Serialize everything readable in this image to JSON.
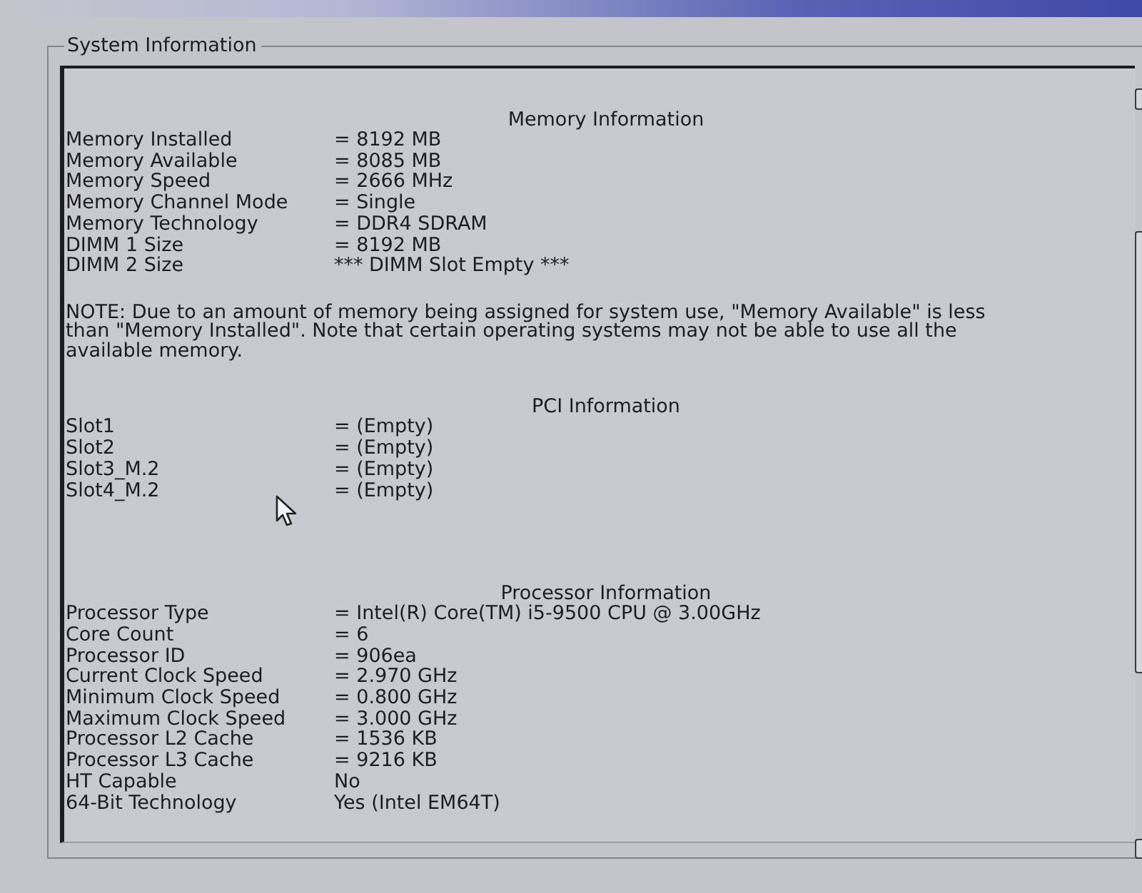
{
  "window": {
    "title": "System Information"
  },
  "sections": [
    {
      "heading": "Memory Information",
      "rows": [
        {
          "label": "Memory Installed",
          "value": "= 8192 MB"
        },
        {
          "label": "Memory Available",
          "value": "= 8085 MB"
        },
        {
          "label": "Memory Speed",
          "value": "= 2666 MHz"
        },
        {
          "label": "Memory Channel Mode",
          "value": "= Single"
        },
        {
          "label": "Memory Technology",
          "value": "= DDR4 SDRAM"
        },
        {
          "label": "DIMM 1 Size",
          "value": "= 8192 MB"
        },
        {
          "label": "DIMM 2 Size",
          "value": "*** DIMM Slot Empty ***"
        }
      ],
      "note": "NOTE: Due to an amount of memory being assigned for system use, \"Memory Available\" is less than \"Memory Installed\". Note that certain operating systems may not be able to use all the available memory."
    },
    {
      "heading": "PCI Information",
      "rows": [
        {
          "label": "Slot1",
          "value": "= (Empty)"
        },
        {
          "label": "Slot2",
          "value": "= (Empty)"
        },
        {
          "label": "Slot3_M.2",
          "value": "= (Empty)"
        },
        {
          "label": "Slot4_M.2",
          "value": "= (Empty)"
        }
      ]
    },
    {
      "heading": "Processor Information",
      "rows": [
        {
          "label": "Processor Type",
          "value": "= Intel(R) Core(TM) i5-9500 CPU @ 3.00GHz"
        },
        {
          "label": "Core Count",
          "value": "= 6"
        },
        {
          "label": "Processor ID",
          "value": "= 906ea"
        },
        {
          "label": "Current Clock Speed",
          "value": "= 2.970 GHz"
        },
        {
          "label": "Minimum Clock Speed",
          "value": "= 0.800 GHz"
        },
        {
          "label": "Maximum Clock Speed",
          "value": "= 3.000 GHz"
        },
        {
          "label": "Processor L2 Cache",
          "value": "= 1536 KB"
        },
        {
          "label": "Processor L3 Cache",
          "value": "= 9216 KB"
        },
        {
          "label": "HT Capable",
          "value": "No"
        },
        {
          "label": "64-Bit Technology",
          "value": "Yes (Intel EM64T)"
        }
      ]
    }
  ]
}
